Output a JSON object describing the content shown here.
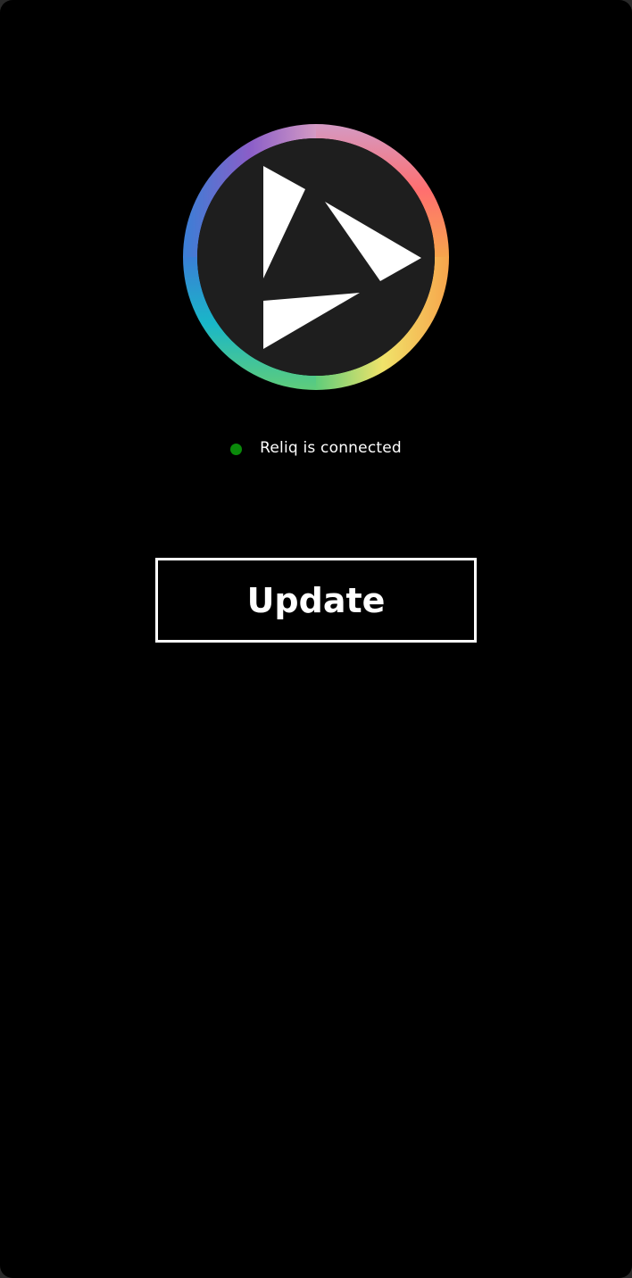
{
  "app": {
    "logo_icon": "reliq-logo-icon",
    "ring_colors": [
      "#8a5ec8",
      "#d49ac4",
      "#ff6f6f",
      "#f7a54c",
      "#f0e36a",
      "#5fcd7a",
      "#19b7c8",
      "#3a7fd6"
    ],
    "logo_fill": "#1e1e1e"
  },
  "status": {
    "text": "Reliq is connected",
    "indicator_color": "#0a8a0a",
    "icon": "status-dot-icon"
  },
  "actions": {
    "update_label": "Update"
  }
}
